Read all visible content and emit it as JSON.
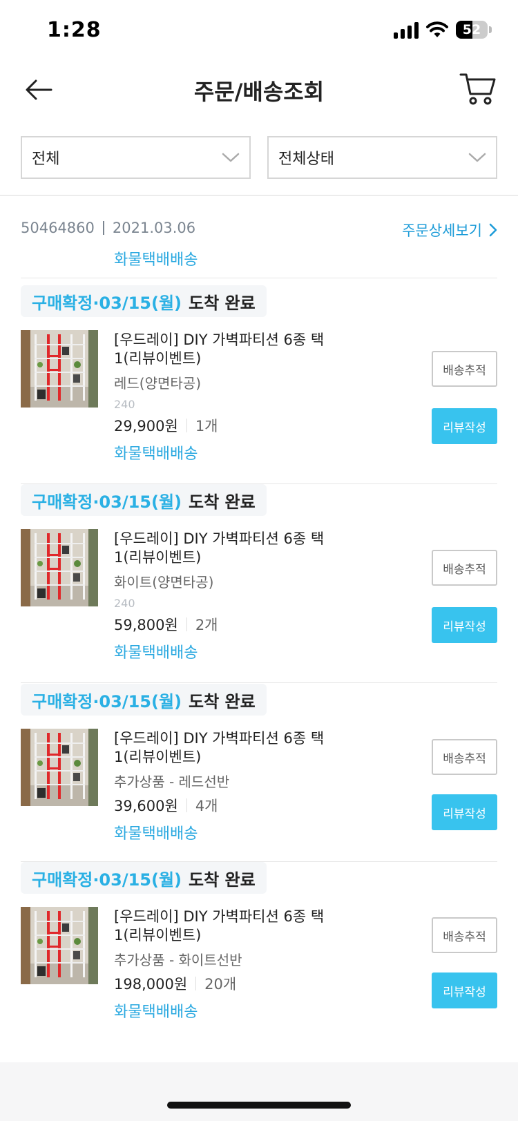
{
  "status_bar": {
    "time": "1:28",
    "battery": "52",
    "battery_level": 0.52
  },
  "header": {
    "title": "주문/배송조회",
    "back_icon": "arrow-left-icon",
    "cart_icon": "cart-icon"
  },
  "filters": {
    "period": {
      "value": "전체"
    },
    "status": {
      "value": "전체상태"
    }
  },
  "order": {
    "number": "50464860",
    "date": "2021.03.06",
    "detail_link": "주문상세보기",
    "shipping": "화물택배배송"
  },
  "items": [
    {
      "status": "구매확정·03/15(월)",
      "arrival": "도착 완료",
      "name": "[우드레이] DIY 가벽파티션 6종 택1(리뷰이벤트)",
      "option": "레드(양면타공)",
      "code": "240",
      "price": "29,900원",
      "qty": "1개",
      "shipping": "화물택배배송",
      "track_label": "배송추적",
      "review_label": "리뷰작성",
      "accent": "#e0282a"
    },
    {
      "status": "구매확정·03/15(월)",
      "arrival": "도착 완료",
      "name": "[우드레이] DIY 가벽파티션 6종 택1(리뷰이벤트)",
      "option": "화이트(양면타공)",
      "code": "240",
      "price": "59,800원",
      "qty": "2개",
      "shipping": "화물택배배송",
      "track_label": "배송추적",
      "review_label": "리뷰작성",
      "accent": "#e0282a"
    },
    {
      "status": "구매확정·03/15(월)",
      "arrival": "도착 완료",
      "name": "[우드레이] DIY 가벽파티션 6종 택1(리뷰이벤트)",
      "option": "추가상품 - 레드선반",
      "code": "",
      "price": "39,600원",
      "qty": "4개",
      "shipping": "화물택배배송",
      "track_label": "배송추적",
      "review_label": "리뷰작성",
      "accent": "#e0282a"
    },
    {
      "status": "구매확정·03/15(월)",
      "arrival": "도착 완료",
      "name": "[우드레이] DIY 가벽파티션 6종 택1(리뷰이벤트)",
      "option": "추가상품 - 화이트선반",
      "code": "",
      "price": "198,000원",
      "qty": "20개",
      "shipping": "화물택배배송",
      "track_label": "배송추적",
      "review_label": "리뷰작성",
      "accent": "#e0282a"
    }
  ],
  "colors": {
    "accent_blue": "#2ab0e4",
    "review_button": "#38c3ee",
    "link_blue": "#1b9bd8"
  }
}
